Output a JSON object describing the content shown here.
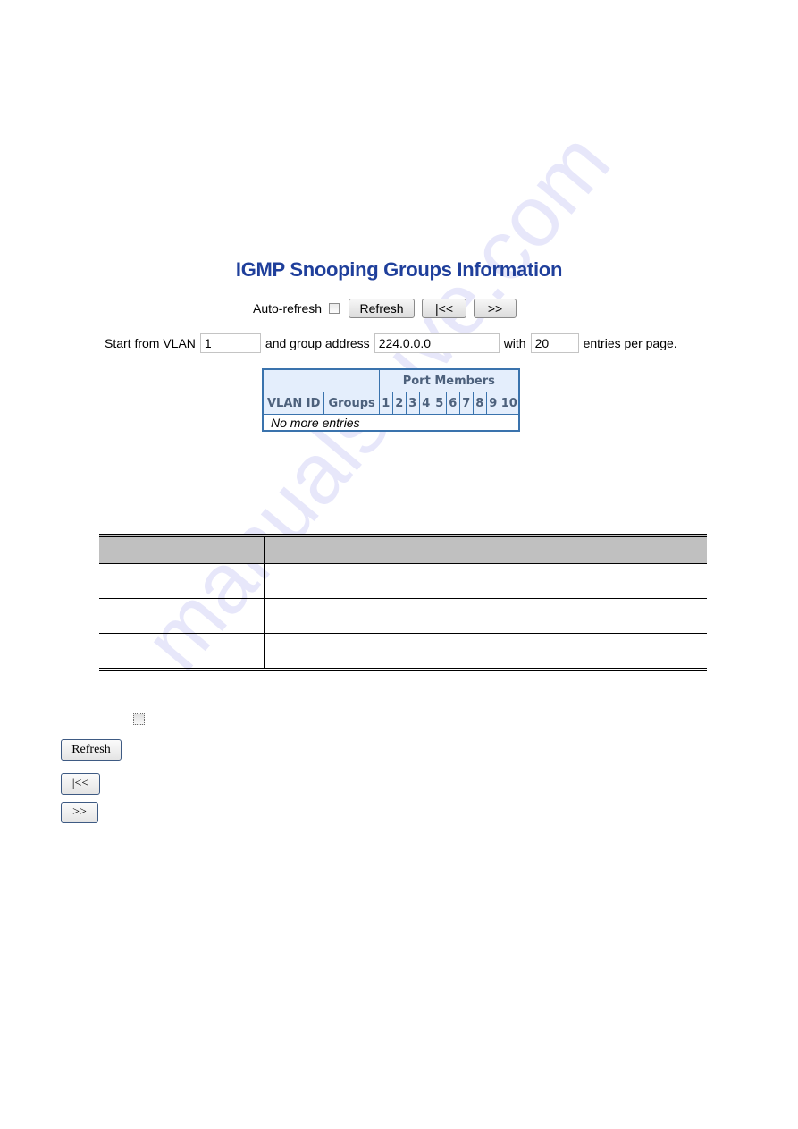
{
  "page": {
    "title": "IGMP Snooping Groups Information",
    "watermark": "manualshive.com"
  },
  "controls": {
    "auto_refresh_label": "Auto-refresh",
    "auto_refresh_checked": false,
    "refresh_label": "Refresh",
    "first_page_label": "|<<",
    "next_page_label": ">>"
  },
  "filter": {
    "start_from_vlan_label": "Start from VLAN",
    "vlan_value": "1",
    "group_address_label": "and group address",
    "group_address_value": "224.0.0.0",
    "with_label": "with",
    "entries_value": "20",
    "entries_suffix": "entries per page."
  },
  "groups_table": {
    "port_members_header": "Port Members",
    "columns": [
      "VLAN ID",
      "Groups"
    ],
    "ports": [
      "1",
      "2",
      "3",
      "4",
      "5",
      "6",
      "7",
      "8",
      "9",
      "10"
    ],
    "empty_message": "No more entries"
  },
  "description_table": {
    "headers": [
      "",
      ""
    ],
    "rows": [
      [
        "",
        ""
      ],
      [
        "",
        ""
      ],
      [
        "",
        ""
      ]
    ]
  },
  "legend": {
    "refresh_label": "Refresh",
    "first_page_label": "|<<",
    "next_page_label": ">>"
  }
}
